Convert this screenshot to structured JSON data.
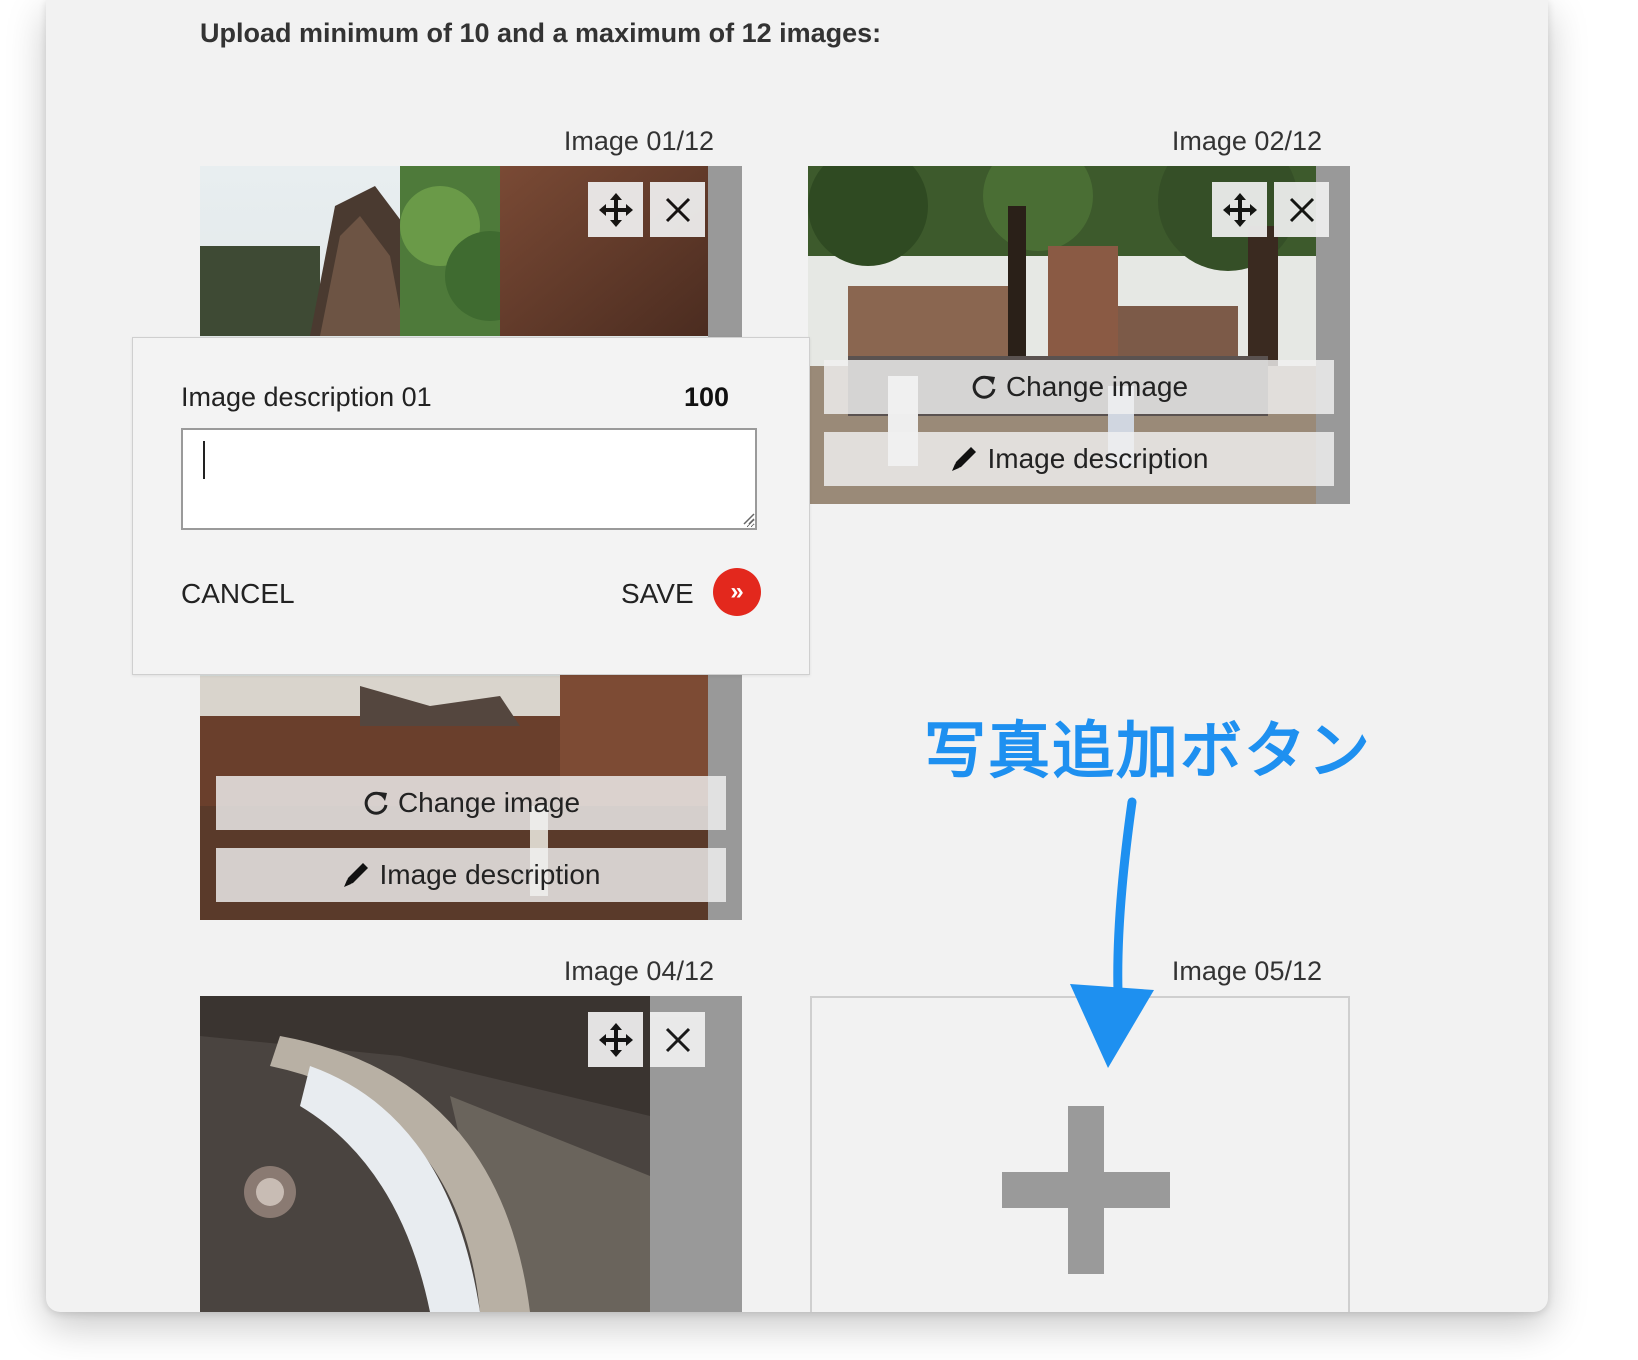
{
  "heading": "Upload minimum of 10 and a maximum of 12 images:",
  "captions": {
    "image1": "Image 01/12",
    "image2": "Image 02/12",
    "image4": "Image 04/12",
    "image5": "Image 05/12"
  },
  "actions": {
    "change_image": "Change image",
    "image_description": "Image description"
  },
  "modal": {
    "label": "Image description 01",
    "char_count": "100",
    "textarea_value": "",
    "cancel_label": "CANCEL",
    "save_label": "SAVE",
    "save_icon": "»"
  },
  "annotation": {
    "text": "写真追加ボタン",
    "color": "#1e90f0"
  },
  "icons": {
    "move": "move-arrows-icon",
    "remove": "close-icon",
    "refresh": "refresh-icon",
    "pencil": "pencil-icon",
    "plus": "plus-icon"
  },
  "colors": {
    "save_button": "#e3281d",
    "panel_background": "#f2f2f2"
  }
}
